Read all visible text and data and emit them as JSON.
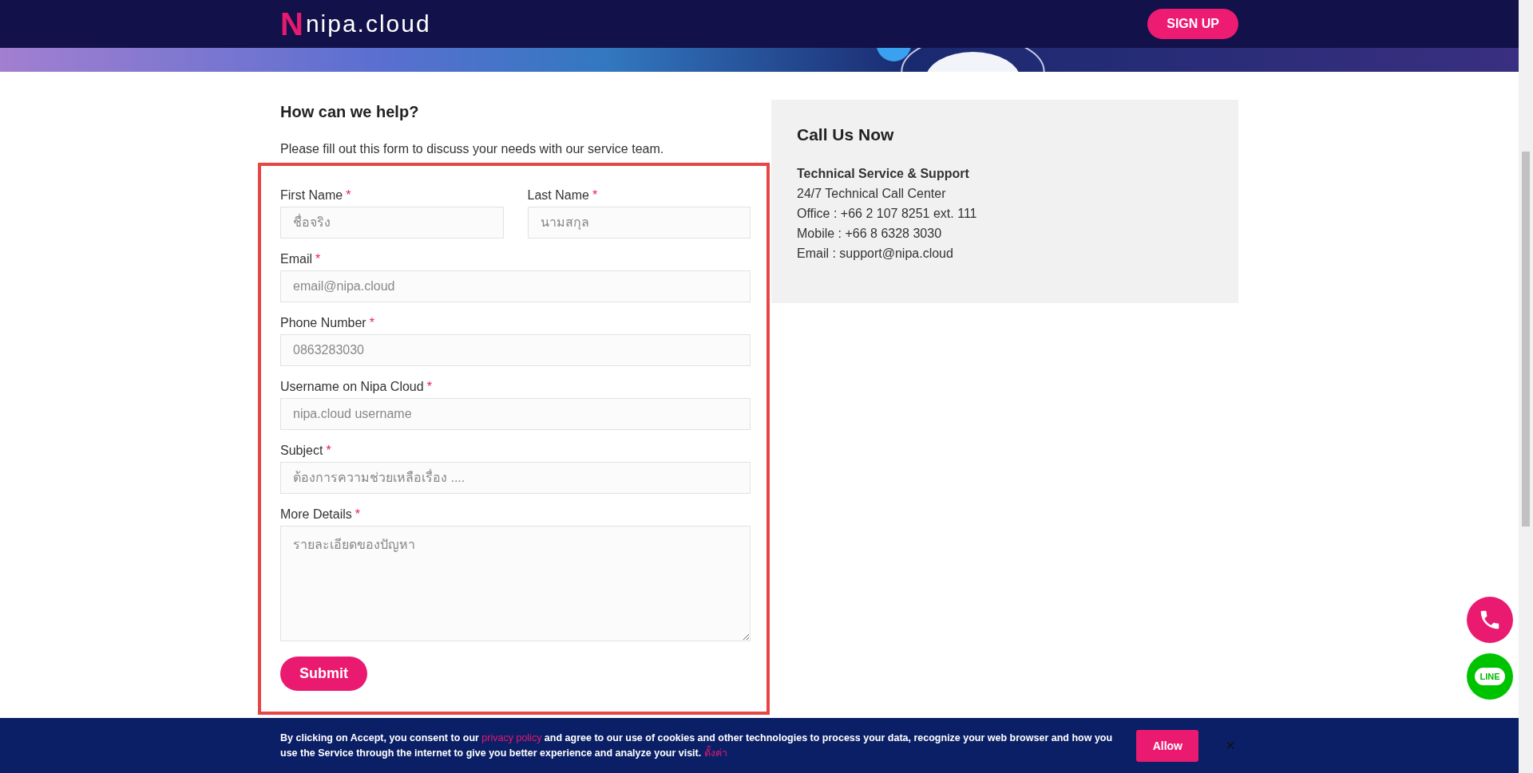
{
  "header": {
    "logo": {
      "mark": "N",
      "text": "nipa.cloud"
    },
    "signup_button": "SIGN UP"
  },
  "form_section": {
    "heading": "How can we help?",
    "intro": "Please fill out this form to discuss your needs with our service team.",
    "fields": [
      {
        "label": "First Name",
        "required_mark": "*",
        "placeholder": "ชื่อจริง",
        "kind": "input"
      },
      {
        "label": "Last Name",
        "required_mark": "*",
        "placeholder": "นามสกุล",
        "kind": "input"
      },
      {
        "label": "Email",
        "required_mark": "*",
        "placeholder": "email@nipa.cloud",
        "kind": "input"
      },
      {
        "label": "Phone Number",
        "required_mark": "*",
        "placeholder": "0863283030",
        "kind": "input"
      },
      {
        "label": "Username on Nipa Cloud",
        "required_mark": "*",
        "placeholder": "nipa.cloud username",
        "kind": "input"
      },
      {
        "label": "Subject",
        "required_mark": "*",
        "placeholder": "ต้องการความช่วยเหลือเรื่อง ....",
        "kind": "input"
      },
      {
        "label": "More Details",
        "required_mark": "*",
        "placeholder": "รายละเอียดของปัญหา",
        "kind": "textarea"
      }
    ],
    "submit_button": "Submit"
  },
  "contact_card": {
    "heading": "Call Us Now",
    "title": "Technical Service & Support",
    "lines": [
      "24/7 Technical Call Center",
      "Office : +66 2 107 8251 ext. 111",
      "Mobile : +66 8 6328 3030",
      "Email : support@nipa.cloud"
    ]
  },
  "cookie_bar": {
    "text_before": "By clicking on Accept, you consent to our ",
    "privacy_link": "privacy policy",
    "text_after": " and agree to our use of cookies and other technologies to process your data, recognize your web browser and how you use the Service through the internet to give you better experience and analyze your visit. ",
    "settings_link": "ตั้งค่า",
    "allow_button": "Allow",
    "close_button": "×"
  },
  "float_buttons": {
    "line_label": "LINE"
  }
}
